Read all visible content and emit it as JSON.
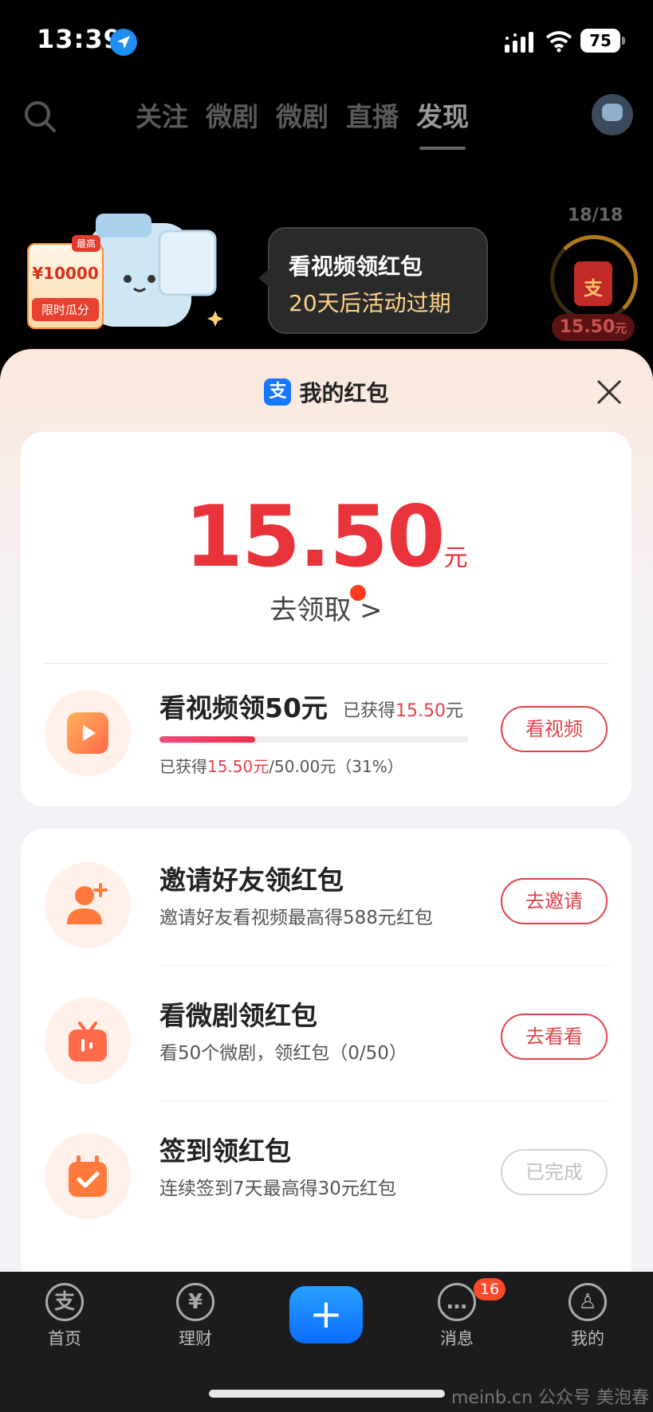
{
  "status_bar": {
    "time": "13:39",
    "battery": "75"
  },
  "top_nav": {
    "tabs": [
      {
        "label": "关注"
      },
      {
        "label": "微剧"
      },
      {
        "label": "微剧"
      },
      {
        "label": "直播"
      },
      {
        "label": "发现"
      }
    ],
    "active_tab": "发现"
  },
  "banner": {
    "coupon_top": "最高",
    "coupon_amount": "¥10000",
    "coupon_label": "限时瓜分",
    "bubble_line1": "看视频领红包",
    "bubble_line2": "20天后活动过期",
    "counter": "18/18",
    "redpack_glyph": "支",
    "amount_value": "15.50",
    "amount_unit": "元"
  },
  "sheet": {
    "logo_glyph": "支",
    "title": "我的红包",
    "balance": {
      "value": "15.50",
      "unit": "元",
      "claim_label": "去领取",
      "claim_chevron": ">"
    },
    "main_task": {
      "name": "看视频领50元",
      "earned_prefix": "已获得",
      "earned_value": "15.50",
      "earned_unit": "元",
      "progress_fraction": 0.31,
      "progress_prefix": "已获得",
      "progress_value": "15.50元",
      "progress_suffix": "/50.00元（31%）",
      "button": "看视频"
    },
    "tasks": [
      {
        "name": "邀请好友领红包",
        "desc": "邀请好友看视频最高得588元红包",
        "button": "去邀请",
        "done": false
      },
      {
        "name": "看微剧领红包",
        "desc": "看50个微剧，领红包（0/50）",
        "button": "去看看",
        "done": false
      },
      {
        "name": "签到领红包",
        "desc": "连续签到7天最高得30元红包",
        "button": "已完成",
        "done": true
      }
    ]
  },
  "tab_bar": {
    "items": [
      {
        "label": "首页",
        "glyph": "支"
      },
      {
        "label": "理财",
        "glyph": "¥"
      },
      {
        "label": "消息",
        "glyph": "…"
      },
      {
        "label": "我的",
        "glyph": "♙"
      }
    ],
    "plus_glyph": "+",
    "message_badge": "16",
    "watermark": "meinb.cn  公众号 美泡春"
  },
  "colors": {
    "accent_red": "#e9333a",
    "alipay_blue": "#1677ff",
    "badge": "#ff4a2a"
  }
}
